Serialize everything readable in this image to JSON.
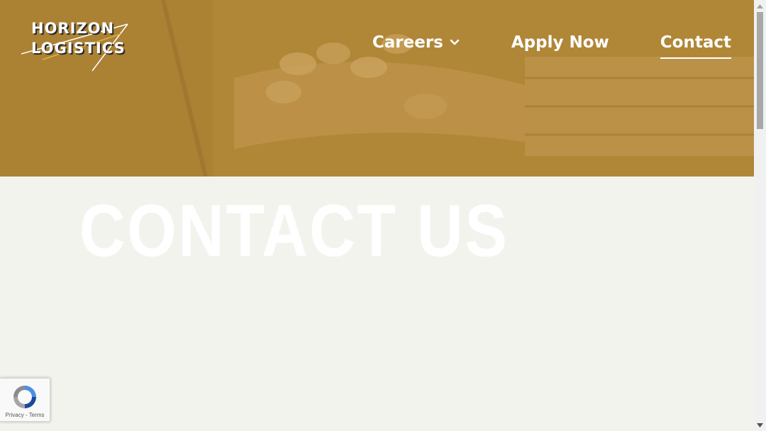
{
  "logo": {
    "line1": "HORIZON",
    "line2": "LOGISTICS"
  },
  "nav": {
    "careers": "Careers",
    "apply": "Apply Now",
    "contact": "Contact"
  },
  "page": {
    "title": "CONTACT US"
  },
  "recaptcha": {
    "privacy": "Privacy",
    "separator": " - ",
    "terms": "Terms"
  },
  "colors": {
    "hero_tint": "#b58a3a",
    "background": "#f3f3ee",
    "title": "#ffffff"
  }
}
